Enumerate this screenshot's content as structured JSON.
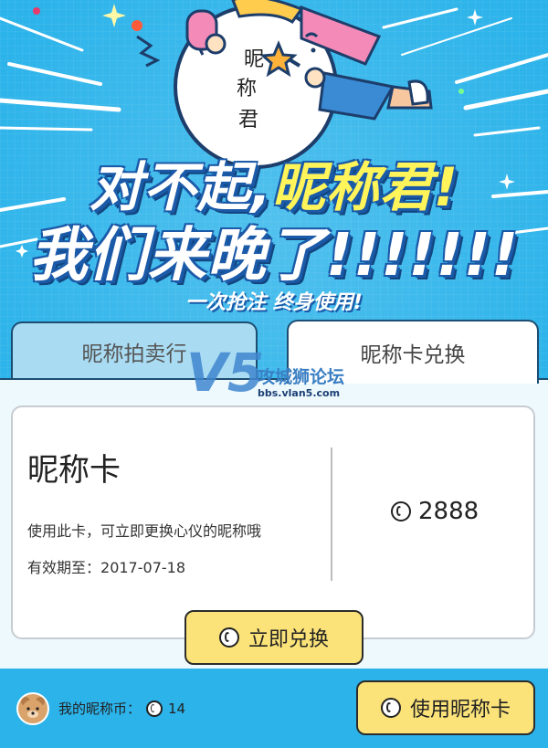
{
  "banner": {
    "mascot_text": "昵称君",
    "headline_1_prefix": "对不起,",
    "headline_1_highlight": "昵称君!",
    "headline_2": "我们来晚了!!!!!!!",
    "tagline": "一次抢注 终身使用!"
  },
  "tabs": [
    {
      "label": "昵称拍卖行",
      "active": false
    },
    {
      "label": "昵称卡兑换",
      "active": true
    }
  ],
  "card": {
    "title": "昵称卡",
    "description": "使用此卡，可立即更换心仪的昵称哦",
    "expiry_label": "有效期至：",
    "expiry_date": "2017-07-18",
    "price": "2888",
    "coin_icon": "coin-icon"
  },
  "actions": {
    "redeem_label": "立即兑换",
    "use_label": "使用昵称卡"
  },
  "footer": {
    "my_coins_label": "我的昵称币：",
    "my_coins_value": "14"
  },
  "watermark": {
    "logo": "V5",
    "title": "攻城狮论坛",
    "url": "bbs.vlan5.com"
  },
  "colors": {
    "background": "#2bb3ea",
    "accent_yellow": "#fbe37a",
    "headline_highlight": "#fff45a",
    "tab_inactive": "#a9dcf2"
  }
}
